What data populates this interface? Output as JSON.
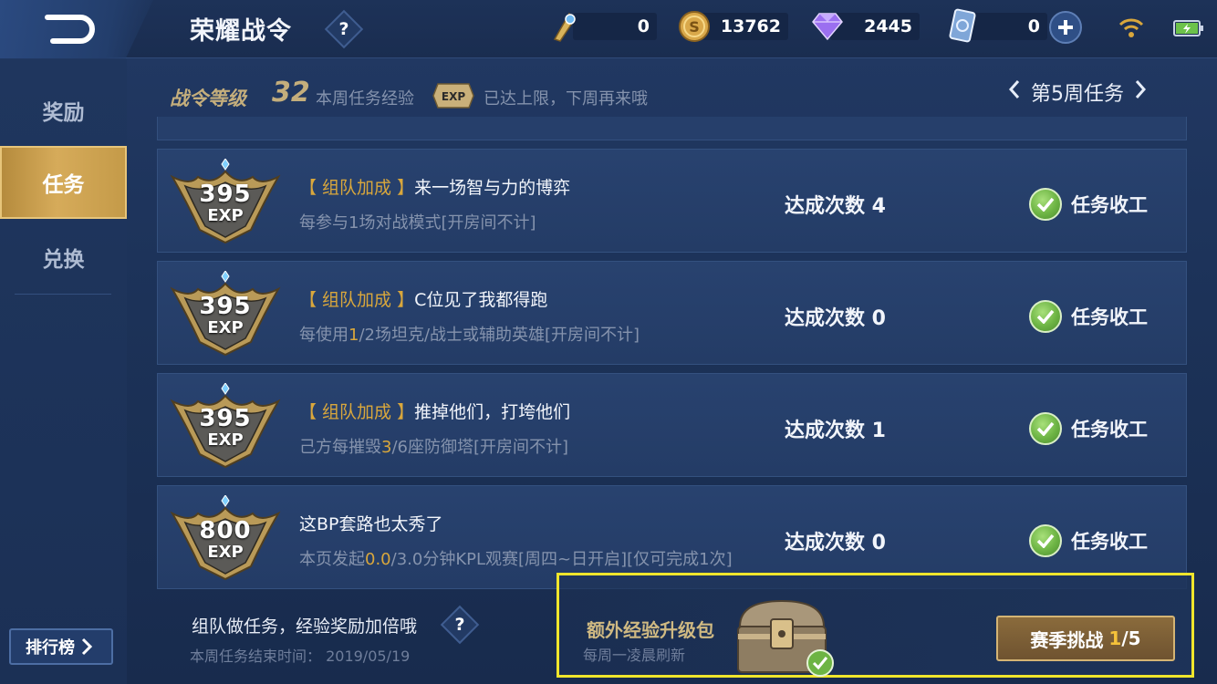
{
  "header": {
    "title": "荣耀战令",
    "currencies": [
      {
        "name": "battle-pass-token",
        "value": "0"
      },
      {
        "name": "gold-coin",
        "value": "13762"
      },
      {
        "name": "diamond",
        "value": "2445"
      },
      {
        "name": "ticket-card",
        "value": "0"
      }
    ]
  },
  "sidebar": {
    "items": [
      {
        "label": "奖励"
      },
      {
        "label": "任务"
      },
      {
        "label": "兑换"
      }
    ],
    "rank_label": "排行榜"
  },
  "pass": {
    "level_label": "战令等级",
    "level": "32",
    "week_exp_label": "本周任务经验",
    "exp_badge": "EXP",
    "limit_text": "已达上限，下周再来哦",
    "week_label": "第5周任务"
  },
  "tasks": [
    {
      "exp": "395",
      "exp_unit": "EXP",
      "tag": "【 组队加成 】",
      "title": "来一场智与力的博弈",
      "desc_a": "每参与1场对战模式[开房间不计]",
      "desc_hl": "",
      "desc_b": "",
      "count": "达成次数 4",
      "status": "任务收工"
    },
    {
      "exp": "395",
      "exp_unit": "EXP",
      "tag": "【 组队加成 】",
      "title": "C位见了我都得跑",
      "desc_a": "每使用",
      "desc_hl": "1",
      "desc_b": "/2场坦克/战士或辅助英雄[开房间不计]",
      "count": "达成次数 0",
      "status": "任务收工"
    },
    {
      "exp": "395",
      "exp_unit": "EXP",
      "tag": "【 组队加成 】",
      "title": "推掉他们，打垮他们",
      "desc_a": "己方每摧毁",
      "desc_hl": "3",
      "desc_b": "/6座防御塔[开房间不计]",
      "count": "达成次数 1",
      "status": "任务收工"
    },
    {
      "exp": "800",
      "exp_unit": "EXP",
      "tag": "",
      "title": "这BP套路也太秀了",
      "desc_a": "本页发起",
      "desc_hl": "0.0",
      "desc_b": "/3.0分钟KPL观赛[周四~日开启][仅可完成1次]",
      "count": "达成次数 0",
      "status": "任务收工"
    }
  ],
  "footer": {
    "team_tip": "组队做任务，经验奖励加倍哦",
    "end_time": "本周任务结束时间： 2019/05/19",
    "bonus_title": "额外经验升级包",
    "bonus_sub": "每周一凌晨刷新",
    "season_label": "赛季挑战",
    "season_progress": "1",
    "season_total": "/5"
  },
  "help_glyph": "?",
  "colors": {
    "accent_gold": "#d9a73c",
    "highlight_box": "#f0e62c",
    "complete_green": "#6db444",
    "active_tab": "#c49a48"
  }
}
